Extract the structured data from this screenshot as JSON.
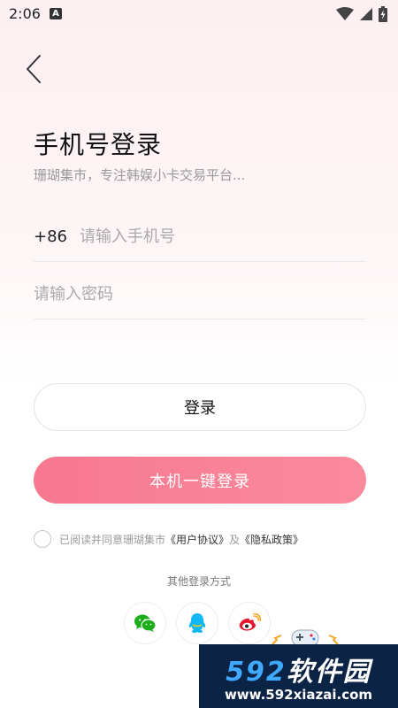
{
  "status_bar": {
    "time": "2:06",
    "notification_icon": "A"
  },
  "header": {
    "title": "手机号登录",
    "subtitle": "珊瑚集市，专注韩娱小卡交易平台..."
  },
  "form": {
    "country_code": "+86",
    "phone_placeholder": "请输入手机号",
    "phone_value": "",
    "password_placeholder": "请输入密码",
    "password_value": ""
  },
  "buttons": {
    "login_label": "登录",
    "onekey_label": "本机一键登录"
  },
  "agreement": {
    "prefix": "已阅读并同意珊瑚集市",
    "user_agreement": "《用户协议》",
    "conjunction": "及",
    "privacy_policy": "《隐私政策》"
  },
  "other_login": {
    "label": "其他登录方式",
    "methods": [
      "wechat-icon",
      "qq-icon",
      "weibo-icon"
    ]
  },
  "watermark": {
    "brand_num": "592",
    "brand_text": "软件园",
    "url": "www.592xiazai.com"
  },
  "colors": {
    "accent": "#f7788f",
    "wechat": "#1aad19",
    "qq": "#12b7f5",
    "weibo": "#e6162d"
  }
}
